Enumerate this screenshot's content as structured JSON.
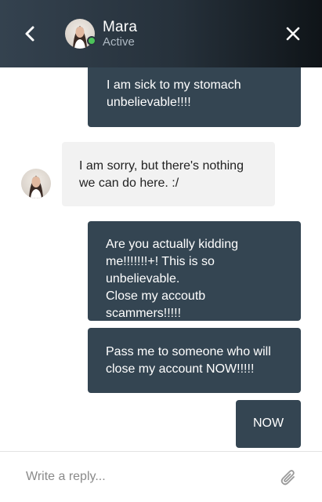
{
  "header": {
    "contact_name": "Mara",
    "contact_status": "Active",
    "status_color": "#4cc35a",
    "back_icon": "chevron-left-icon",
    "close_icon": "close-icon"
  },
  "messages": [
    {
      "sender": "user",
      "text": "I am sick to my stomach\nunbelievable!!!!"
    },
    {
      "sender": "agent",
      "text": "I am sorry, but there's nothing\nwe can do here. :/"
    },
    {
      "sender": "user",
      "text": "Are you actually kidding\nme!!!!!!!+! This is so unbelievable.\nClose my accoutb scammers!!!!!\nThis is god dam stupid"
    },
    {
      "sender": "user",
      "text": "Pass me to someone who will\nclose my account NOW!!!!!"
    },
    {
      "sender": "user",
      "text": "NOW"
    }
  ],
  "composer": {
    "placeholder": "Write a reply...",
    "attach_icon": "paperclip-icon"
  },
  "colors": {
    "outgoing_bubble": "#344552",
    "incoming_bubble": "#f2f2f2",
    "header_dark": "#0f1418"
  }
}
